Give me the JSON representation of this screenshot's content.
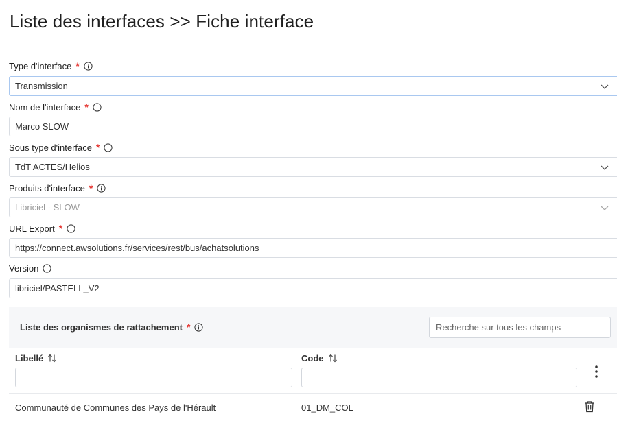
{
  "page": {
    "title": "Liste des interfaces >> Fiche interface"
  },
  "form": {
    "type_interface": {
      "label": "Type d'interface",
      "value": "Transmission"
    },
    "nom_interface": {
      "label": "Nom de l'interface",
      "value": "Marco SLOW"
    },
    "sous_type": {
      "label": "Sous type d'interface",
      "value": "TdT ACTES/Helios"
    },
    "produits": {
      "label": "Produits d'interface",
      "value": "Libriciel - SLOW"
    },
    "url_export": {
      "label": "URL Export",
      "value": "https://connect.awsolutions.fr/services/rest/bus/achatsolutions"
    },
    "version": {
      "label": "Version",
      "value": "libriciel/PASTELL_V2"
    }
  },
  "organismes": {
    "title": "Liste des organismes de rattachement",
    "search_placeholder": "Recherche sur tous les champs",
    "columns": [
      "Libellé",
      "Code"
    ],
    "rows": [
      {
        "libelle": "Communauté de Communes des Pays de l'Hérault",
        "code": "01_DM_COL"
      }
    ]
  },
  "icons": {
    "required": "required-asterisk",
    "info": "info-icon",
    "dropdown": "chevron-down-icon",
    "sort": "sort-icon",
    "menu": "kebab-menu-icon",
    "delete": "trash-icon"
  },
  "colors": {
    "required": "#e53935",
    "focus_border": "#a9c8f0",
    "panel_bg": "#f6f7f9"
  }
}
